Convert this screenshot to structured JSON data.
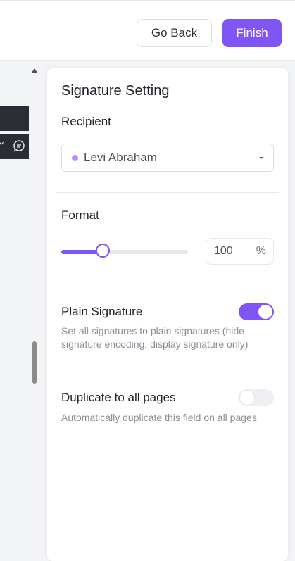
{
  "header": {
    "back_label": "Go Back",
    "finish_label": "Finish"
  },
  "panel": {
    "title": "Signature Setting",
    "recipient": {
      "label": "Recipient",
      "selected": "Levi Abraham",
      "dot_color": "#b98cf5"
    },
    "format": {
      "label": "Format",
      "value": "100",
      "unit": "%",
      "slider_fraction": 0.33
    },
    "plain_signature": {
      "label": "Plain Signature",
      "description": "Set all signatures to plain signatures (hide signature encoding, display signature only)",
      "enabled": true
    },
    "duplicate": {
      "label": "Duplicate to all pages",
      "description": "Automatically duplicate this field on all pages",
      "enabled": false
    }
  },
  "colors": {
    "accent": "#7f56f5",
    "toolbar": "#2b2d35"
  }
}
